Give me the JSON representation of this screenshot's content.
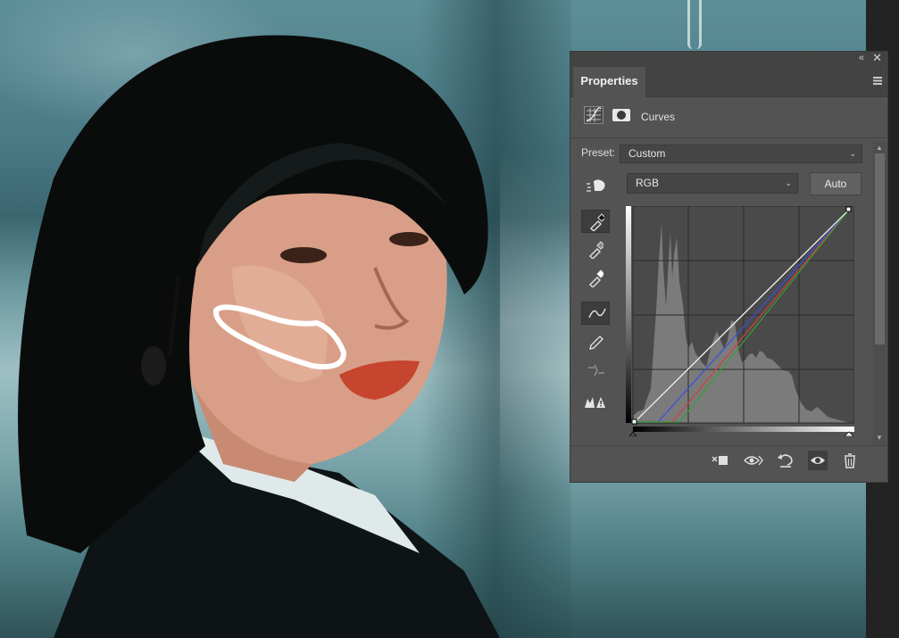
{
  "panel": {
    "tab_label": "Properties",
    "adjustment_title": "Curves",
    "preset_label": "Preset:",
    "preset_value": "Custom",
    "channel_value": "RGB",
    "auto_label": "Auto"
  },
  "icons": {
    "collapse": "«",
    "close": "✕",
    "up": "▲",
    "down": "▼",
    "chevron": "⌄"
  },
  "tools": [
    "sample-in-image-black-icon",
    "sample-in-image-gray-icon",
    "sample-in-image-white-icon",
    "edit-points-curve-icon",
    "draw-pencil-icon",
    "smooth-curve-icon",
    "clipping-warning-icon"
  ],
  "bottom_icons": [
    "clip-to-layer-icon",
    "view-previous-state-icon",
    "reset-icon",
    "toggle-visibility-icon",
    "delete-icon"
  ],
  "colors": {
    "panel_bg": "#535353",
    "panel_dark": "#434343",
    "curve_red": "#d04040",
    "curve_green": "#35a035",
    "curve_blue": "#3a4fe0"
  }
}
